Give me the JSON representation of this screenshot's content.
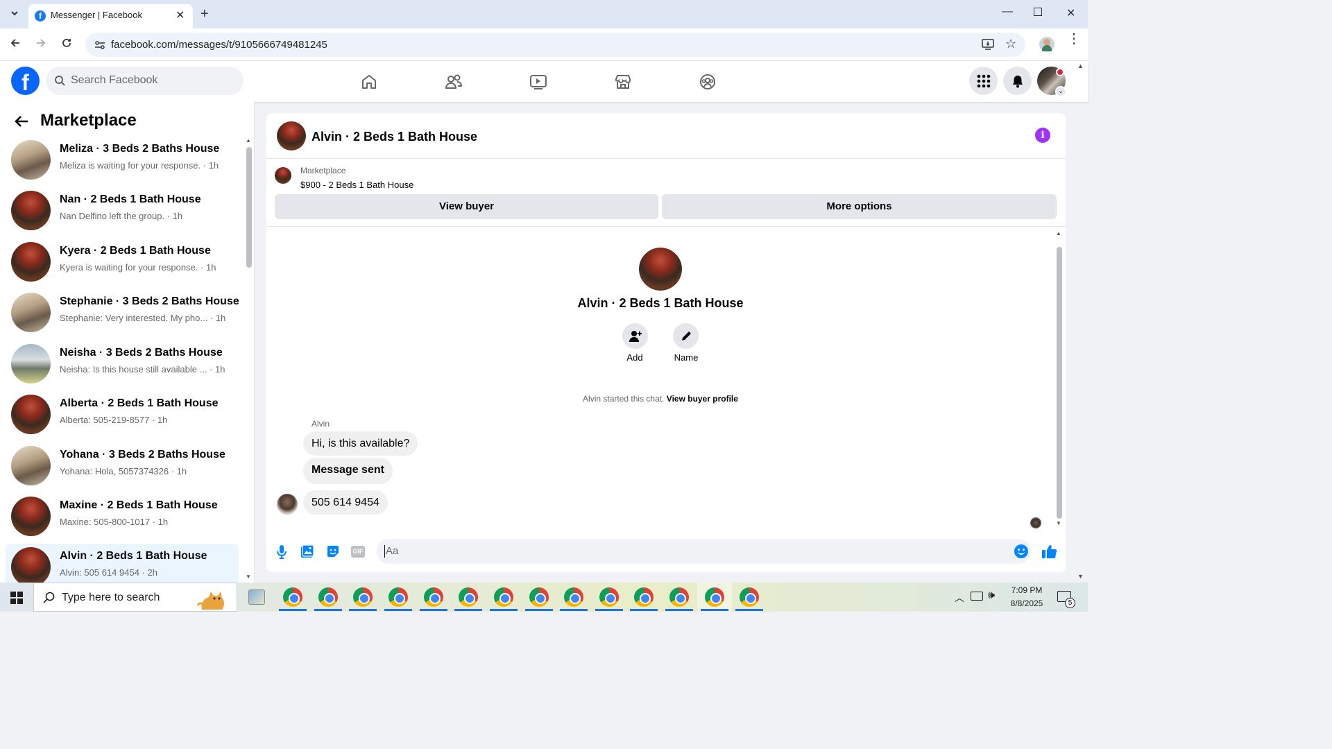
{
  "browser": {
    "tab_title": "Messenger | Facebook",
    "url": "facebook.com/messages/t/9105666749481245"
  },
  "fb_header": {
    "search_placeholder": "Search Facebook"
  },
  "sidebar": {
    "title": "Marketplace",
    "conversations": [
      {
        "title": "Meliza · 3 Beds 2 Baths House",
        "subtitle": "Meliza is waiting for your response. · 1h"
      },
      {
        "title": "Nan · 2 Beds 1 Bath House",
        "subtitle": "Nan Delfino left the group. · 1h"
      },
      {
        "title": "Kyera · 2 Beds 1 Bath House",
        "subtitle": "Kyera is waiting for your response. · 1h"
      },
      {
        "title": "Stephanie · 3 Beds 2 Baths House",
        "subtitle": "Stephanie: Very interested. My pho... · 1h"
      },
      {
        "title": "Neisha · 3 Beds 2 Baths House",
        "subtitle": "Neisha: Is this house still available ...  · 1h"
      },
      {
        "title": "Alberta · 2 Beds 1 Bath House",
        "subtitle": "Alberta: 505-219-8577 · 1h"
      },
      {
        "title": "Yohana · 3 Beds 2 Baths House",
        "subtitle": "Yohana: Hola, 5057374326 · 1h"
      },
      {
        "title": "Maxine · 2 Beds 1 Bath House",
        "subtitle": "Maxine: 505-800-1017 · 1h"
      },
      {
        "title": "Alvin · 2 Beds 1 Bath House",
        "subtitle": "Alvin: 505 614 9454 · 2h"
      }
    ]
  },
  "chat": {
    "header_title": "Alvin · 2 Beds 1 Bath House",
    "listing_source": "Marketplace",
    "listing_text": "$900 - 2 Beds 1 Bath House",
    "view_buyer_label": "View buyer",
    "more_options_label": "More options",
    "profile_name": "Alvin · 2 Beds 1 Bath House",
    "add_label": "Add",
    "name_label": "Name",
    "started_text": "Alvin started this chat.",
    "view_profile_link": "View buyer profile",
    "sender_name": "Alvin",
    "messages": [
      {
        "text": "Hi, is this available?"
      },
      {
        "text": "Message sent"
      },
      {
        "text": "505 614 9454"
      }
    ],
    "composer_placeholder": "Aa"
  },
  "taskbar": {
    "search_placeholder": "Type here to search",
    "time": "7:09 PM",
    "date": "8/8/2025",
    "notification_count": "5"
  },
  "colors": {
    "fb_blue": "#0866ff",
    "messenger_accent": "#0084ff",
    "info_purple": "#a033ff",
    "notification_red": "#e41e3f"
  },
  "icons": [
    "home-icon",
    "friends-icon",
    "video-icon",
    "marketplace-icon",
    "groups-icon",
    "menu-grid-icon",
    "bell-icon",
    "info-icon",
    "microphone-icon",
    "gallery-icon",
    "sticker-icon",
    "gif-icon",
    "emoji-icon",
    "like-icon",
    "add-person-icon",
    "pencil-icon",
    "back-arrow-icon",
    "search-icon"
  ]
}
